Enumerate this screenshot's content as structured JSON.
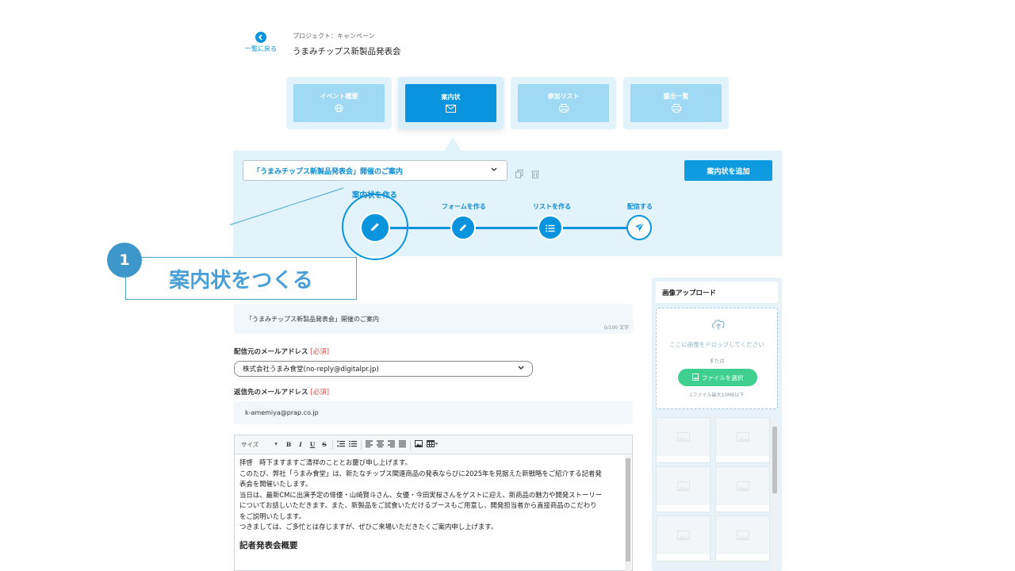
{
  "nav": {
    "back_label": "一覧に戻る",
    "breadcrumb": "プロジェクト：キャンペーン",
    "project_title": "うまみチップス新製品発表会"
  },
  "tabs": [
    {
      "label": "イベント概要",
      "icon": "globe-icon",
      "active": false
    },
    {
      "label": "案内状",
      "icon": "envelope-icon",
      "active": true
    },
    {
      "label": "参加リスト",
      "icon": "printer-icon",
      "active": false
    },
    {
      "label": "露出一覧",
      "icon": "printer-icon",
      "active": false
    }
  ],
  "invitation_panel": {
    "selected_invitation": "「うまみチップス新製品発表会」開催のご案内",
    "add_button": "案内状を追加",
    "steps": [
      {
        "label": "案内状を作る",
        "icon": "pencil-icon",
        "current": true
      },
      {
        "label": "フォームを作る",
        "icon": "pencil-icon",
        "current": false
      },
      {
        "label": "リストを作る",
        "icon": "list-icon",
        "current": false
      },
      {
        "label": "配信する",
        "icon": "send-icon",
        "current": false
      }
    ]
  },
  "callout": {
    "number": "1",
    "text": "案内状をつくる"
  },
  "form": {
    "subject_value": "「うまみチップス新製品発表会」開催のご案内",
    "subject_counter": "0/100 文字",
    "from_label": "配信元のメールアドレス",
    "required_mark": "[必須]",
    "from_value": "株式会社うまみ食堂(no-reply@digitalpr.jp)",
    "reply_label": "返信先のメールアドレス",
    "reply_value": "k-amemiya@prap.co.jp"
  },
  "editor": {
    "size_label": "サイズ",
    "lines": [
      "拝啓　時下ますますご清祥のこととお慶び申し上げます。",
      "このたび、弊社「うまみ食堂」は、新たなチップス関連商品の発表ならびに2025年を見据えた新戦略をご紹介する記者発",
      "表会を開催いたします。",
      "当日は、最新CMに出演予定の俳優・山崎賢斗さん、女優・今田実桜さんをゲストに迎え、新商品の魅力や開発ストーリー",
      "についてお話しいただきます。また、新製品をご試食いただけるブースもご用意し、開発担当者から直接商品のこだわり",
      "をご説明いたします。",
      "つきましては、ご多忙とは存じますが、ぜひご来場いただきたくご案内申し上げます。"
    ],
    "heading": "記者発表会概要"
  },
  "upload": {
    "title": "画像アップロード",
    "drop_text": "ここに画像をドロップしてください",
    "or_text": "または",
    "choose_button": "ファイルを選択",
    "limit_text": "1ファイル最大10MB以下"
  },
  "colors": {
    "primary": "#0a94de",
    "tab_inactive": "#9fd9f4",
    "panel_bg": "#e3f3fb",
    "callout": "#4aa0d6",
    "upload_button": "#3fcf8e",
    "required": "#e04a4a"
  }
}
